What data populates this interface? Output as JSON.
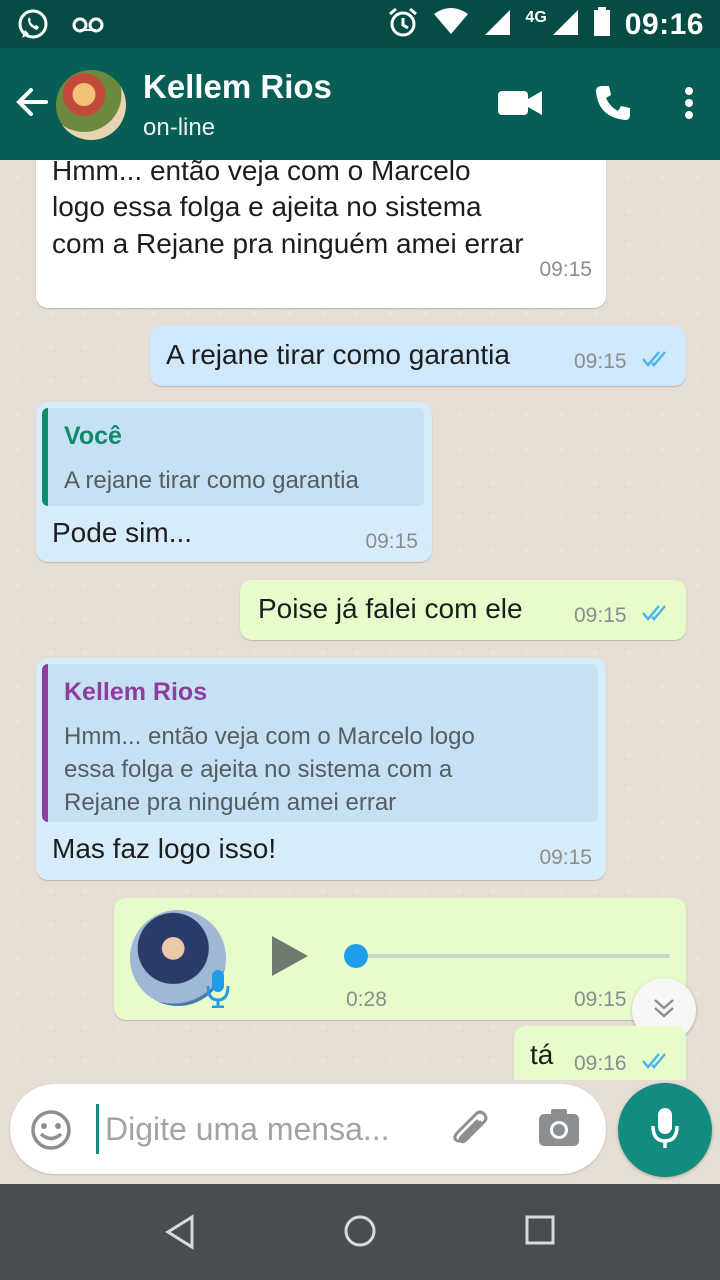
{
  "statusbar": {
    "time": "09:16",
    "network": "4G"
  },
  "header": {
    "name": "Kellem Rios",
    "status": "on-line"
  },
  "messages": [
    {
      "lines": [
        "Hmm... então veja com o Marcelo",
        "logo essa folga e ajeita no sistema",
        "com a Rejane pra ninguém amei errar"
      ],
      "time": "09:15"
    },
    {
      "text": "A rejane tirar como garantia",
      "time": "09:15"
    },
    {
      "quote_author": "Você",
      "quote_text": "A rejane tirar como garantia",
      "text": "Pode sim...",
      "time": "09:15"
    },
    {
      "text": "Poise já falei com ele",
      "time": "09:15"
    },
    {
      "quote_author": "Kellem Rios",
      "quote_lines": [
        "Hmm... então veja com o Marcelo logo",
        "essa folga e ajeita no sistema com a",
        "Rejane pra ninguém amei errar"
      ],
      "text": "Mas faz logo isso!",
      "time": "09:15"
    },
    {
      "duration": "0:28",
      "time": "09:15"
    },
    {
      "text": "tá",
      "time": "09:16"
    }
  ],
  "input": {
    "placeholder": "Digite uma mensa..."
  },
  "colors": {
    "header": "#075e54",
    "accent": "#128c7e",
    "quote_self": "#0f8a6a",
    "quote_other": "#8e3d9e",
    "ticks": "#4fb6ec"
  },
  "icons": [
    "whatsapp-icon",
    "voicemail-icon",
    "alarm-icon",
    "wifi-icon",
    "signal-icon",
    "battery-icon",
    "back-arrow-icon",
    "video-call-icon",
    "phone-icon",
    "more-vert-icon",
    "double-check-icon",
    "play-icon",
    "mic-icon",
    "chevron-down-icon",
    "emoji-icon",
    "attach-icon",
    "camera-icon",
    "nav-back-icon",
    "nav-home-icon",
    "nav-recents-icon"
  ]
}
